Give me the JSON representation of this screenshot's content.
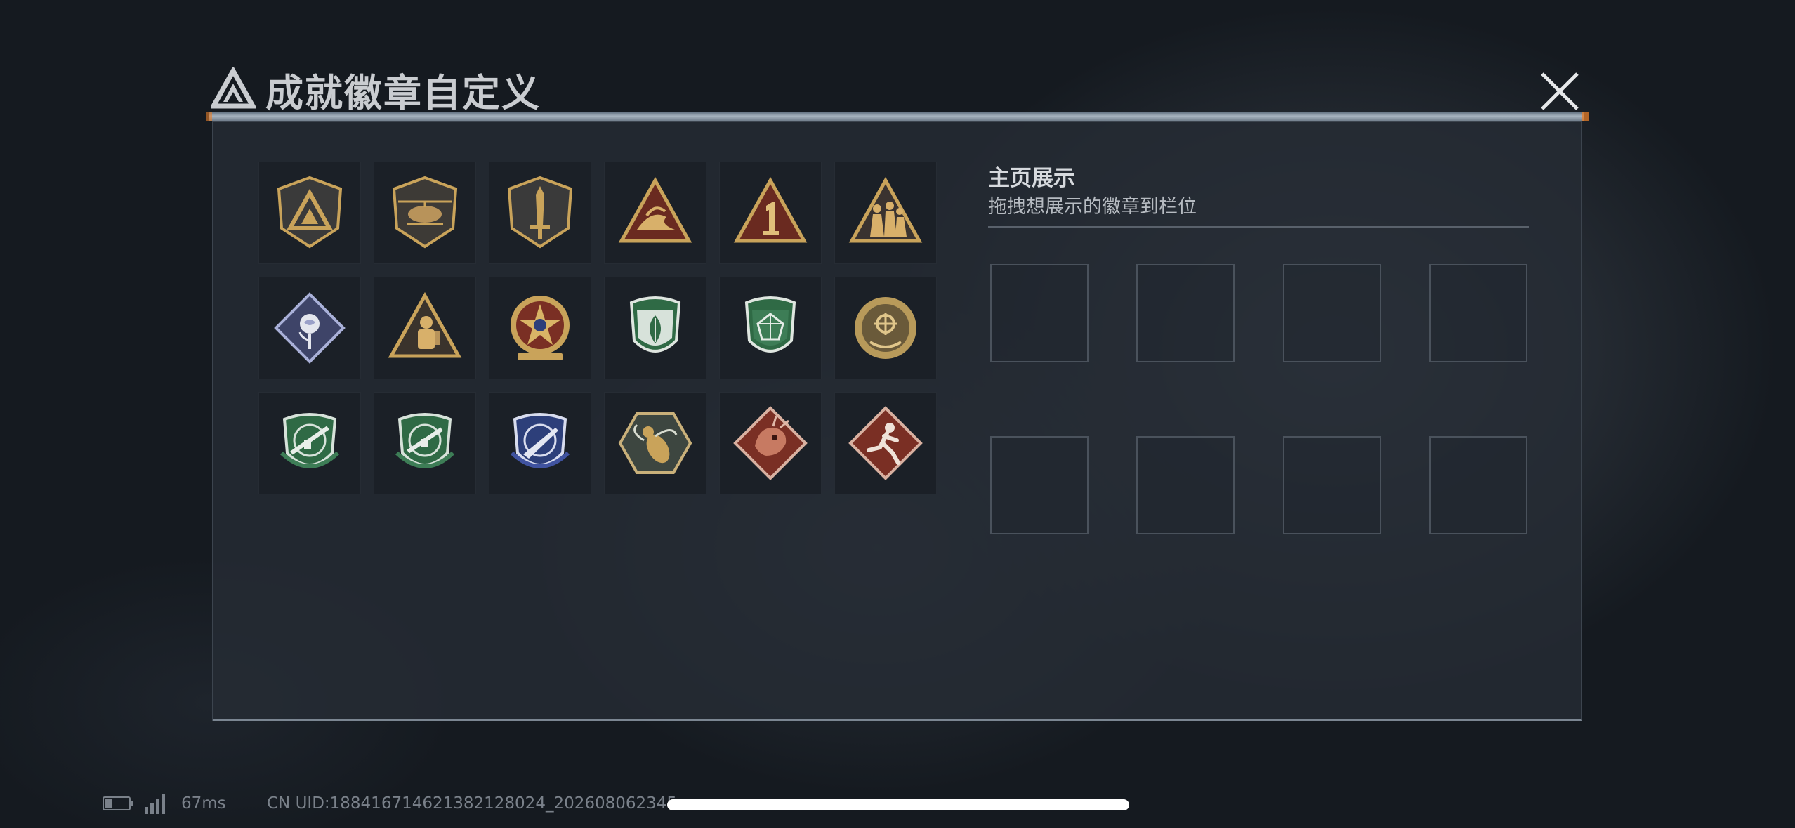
{
  "window": {
    "title": "成就徽章自定义"
  },
  "badges": [
    {
      "icon": "triangle-shield-badge-icon"
    },
    {
      "icon": "helicopter-badge-icon"
    },
    {
      "icon": "dagger-shield-badge-icon"
    },
    {
      "icon": "triangle-wave-badge-icon"
    },
    {
      "icon": "triangle-number-one-badge-icon"
    },
    {
      "icon": "triangle-soldiers-badge-icon"
    },
    {
      "icon": "rose-diamond-badge-icon"
    },
    {
      "icon": "triangle-diver-badge-icon"
    },
    {
      "icon": "star-medal-badge-icon"
    },
    {
      "icon": "green-leaf-shield-badge-icon"
    },
    {
      "icon": "green-gem-shield-badge-icon"
    },
    {
      "icon": "gold-round-crest-badge-icon"
    },
    {
      "icon": "green-rifle-shield-badge-icon"
    },
    {
      "icon": "green-rifle-shield-alt-badge-icon"
    },
    {
      "icon": "blue-knife-shield-badge-icon"
    },
    {
      "icon": "wasp-hexagon-badge-icon"
    },
    {
      "icon": "red-dragon-diamond-badge-icon"
    },
    {
      "icon": "red-runner-diamond-badge-icon"
    }
  ],
  "showcase": {
    "title": "主页展示",
    "subtitle": "拖拽想展示的徽章到栏位",
    "slot_count": 8
  },
  "status": {
    "latency": "67ms",
    "uid": "CN UID:18841671462138212802​4_2026080623​45"
  },
  "colors": {
    "gold": "#c9a35a",
    "green": "#2f6a45",
    "blue": "#2d3f7a",
    "red": "#7a2f24",
    "panel": "#262c34"
  }
}
